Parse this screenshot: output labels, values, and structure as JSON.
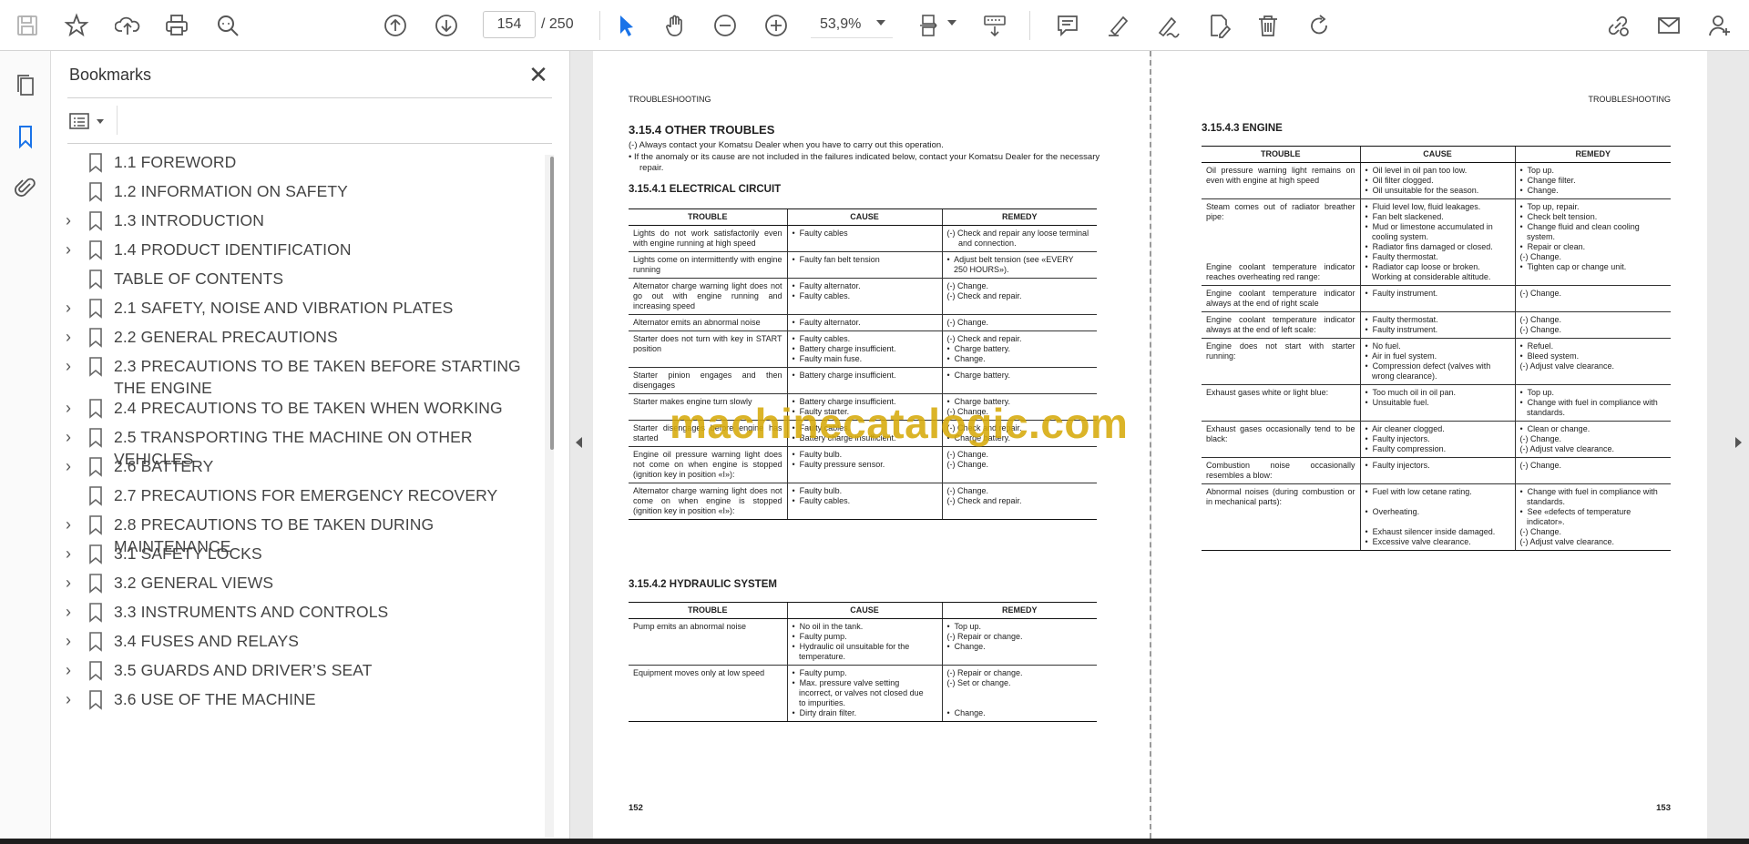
{
  "toolbar": {
    "page_current": "154",
    "page_total": "/  250",
    "zoom": "53,9%"
  },
  "bookmarks": {
    "title": "Bookmarks",
    "items": [
      {
        "label": "1.1 FOREWORD",
        "expandable": false
      },
      {
        "label": "1.2 INFORMATION ON SAFETY",
        "expandable": false
      },
      {
        "label": "1.3 INTRODUCTION",
        "expandable": true
      },
      {
        "label": "1.4 PRODUCT IDENTIFICATION",
        "expandable": true
      },
      {
        "label": "TABLE OF CONTENTS",
        "expandable": false
      },
      {
        "label": "2.1 SAFETY, NOISE AND VIBRATION PLATES",
        "expandable": true
      },
      {
        "label": "2.2 GENERAL PRECAUTIONS",
        "expandable": true
      },
      {
        "label": "2.3 PRECAUTIONS TO BE TAKEN BEFORE STARTING THE ENGINE",
        "expandable": true
      },
      {
        "label": "2.4 PRECAUTIONS TO BE TAKEN WHEN WORKING",
        "expandable": true
      },
      {
        "label": "2.5 TRANSPORTING THE MACHINE ON OTHER VEHICLES",
        "expandable": true
      },
      {
        "label": "2.6 BATTERY",
        "expandable": true
      },
      {
        "label": "2.7 PRECAUTIONS FOR EMERGENCY RECOVERY",
        "expandable": false
      },
      {
        "label": "2.8 PRECAUTIONS TO BE TAKEN DURING MAINTENANCE",
        "expandable": true
      },
      {
        "label": "3.1 SAFETY LOCKS",
        "expandable": true
      },
      {
        "label": "3.2 GENERAL VIEWS",
        "expandable": true
      },
      {
        "label": "3.3 INSTRUMENTS AND CONTROLS",
        "expandable": true
      },
      {
        "label": "3.4 FUSES AND RELAYS",
        "expandable": true
      },
      {
        "label": "3.5 GUARDS AND DRIVER’S SEAT",
        "expandable": true
      },
      {
        "label": "3.6 USE OF THE MACHINE",
        "expandable": true
      }
    ]
  },
  "page_left": {
    "running_head": "TROUBLESHOOTING",
    "heading": "3.15.4 OTHER TROUBLES",
    "note1": "(-) Always contact your Komatsu Dealer when you have to carry out this operation.",
    "note2": "•   If the anomaly or its cause are not included in the failures indicated below, contact your Komatsu Dealer for the necessary repair.",
    "sub1": "3.15.4.1  ELECTRICAL CIRCUIT",
    "sub2": "3.15.4.2  HYDRAULIC SYSTEM",
    "page_number": "152",
    "headers": [
      "TROUBLE",
      "CAUSE",
      "REMEDY"
    ],
    "electrical_rows": [
      {
        "trouble": "Lights do not work satisfactorily even with engine running at high speed",
        "cause": [
          "•  Faulty cables"
        ],
        "remedy": [
          "(-) Check and repair any loose terminal",
          "     and connection."
        ]
      },
      {
        "trouble": "Lights come on intermittently with engine running",
        "cause": [
          "•  Faulty fan belt tension"
        ],
        "remedy": [
          "•  Adjust belt tension (see «EVERY",
          "   250 HOURS»)."
        ]
      },
      {
        "trouble": "Alternator charge warning light does not go out with engine running and increasing speed",
        "cause": [
          "•  Faulty alternator.",
          "•  Faulty cables."
        ],
        "remedy": [
          "(-) Change.",
          "(-) Check and repair."
        ]
      },
      {
        "trouble": "Alternator emits an abnormal noise",
        "cause": [
          "•  Faulty alternator."
        ],
        "remedy": [
          "(-) Change."
        ]
      },
      {
        "trouble": "Starter does not turn with key in START position",
        "cause": [
          "•  Faulty cables.",
          "•  Battery charge insufficient.",
          "•  Faulty main fuse."
        ],
        "remedy": [
          "(-) Check and repair.",
          "•  Charge battery.",
          "•  Change."
        ]
      },
      {
        "trouble": "Starter pinion engages and then disengages",
        "cause": [
          "•  Battery charge insufficient."
        ],
        "remedy": [
          "•  Charge battery."
        ]
      },
      {
        "trouble": "Starter makes engine turn slowly",
        "cause": [
          "•  Battery charge insufficient.",
          "•  Faulty starter."
        ],
        "remedy": [
          "•  Charge battery.",
          "(-) Change."
        ]
      },
      {
        "trouble": "Starter disengages before engine has started",
        "cause": [
          "•  Faulty cables.",
          "•  Battery charge insufficient."
        ],
        "remedy": [
          "(-) Check and repair.",
          "•  Charge battery."
        ]
      },
      {
        "trouble": "Engine oil pressure warning light does not come on when engine is stopped (ignition key in position «I»):",
        "cause": [
          "•  Faulty bulb.",
          "•  Faulty pressure sensor."
        ],
        "remedy": [
          "(-) Change.",
          "(-) Change."
        ]
      },
      {
        "trouble": "Alternator charge warning light does not come on when engine is stopped (ignition key in position «I»):",
        "cause": [
          "•  Faulty bulb.",
          "•  Faulty cables."
        ],
        "remedy": [
          "(-) Change.",
          "(-) Check and repair."
        ]
      }
    ],
    "hydraulic_rows": [
      {
        "trouble": "Pump emits an abnormal noise",
        "cause": [
          "•  No oil in the tank.",
          "•  Faulty pump.",
          "•  Hydraulic oil unsuitable for the",
          "   temperature."
        ],
        "remedy": [
          "•  Top up.",
          "(-) Repair or change.",
          "•  Change."
        ]
      },
      {
        "trouble": "Equipment moves only at low speed",
        "cause": [
          "•  Faulty pump.",
          "•  Max. pressure valve setting",
          "   incorrect, or valves not closed due",
          "   to impurities.",
          "•  Dirty drain filter."
        ],
        "remedy": [
          "(-) Repair or change.",
          "(-) Set or change.",
          "",
          "",
          "•  Change."
        ]
      }
    ]
  },
  "page_right": {
    "running_head": "TROUBLESHOOTING",
    "heading": "3.15.4.3  ENGINE",
    "page_number": "153",
    "headers": [
      "TROUBLE",
      "CAUSE",
      "REMEDY"
    ],
    "engine_rows": [
      {
        "trouble": "Oil pressure warning light remains on even with engine at high speed",
        "cause": [
          "•  Oil level in oil pan too low.",
          "•  Oil filter clogged.",
          "•  Oil unsuitable for the season."
        ],
        "remedy": [
          "•  Top up.",
          "•  Change filter.",
          "•  Change."
        ]
      },
      {
        "trouble": "Steam comes out of radiator breather pipe:\n\n\n\n\nEngine coolant temperature indicator reaches overheating red range:",
        "cause": [
          "•  Fluid level low, fluid leakages.",
          "•  Fan belt slackened.",
          "•  Mud or limestone accumulated in",
          "   cooling system.",
          "•  Radiator fins damaged or closed.",
          "•  Faulty thermostat.",
          "•  Radiator cap loose or broken.",
          "   Working at considerable altitude."
        ],
        "remedy": [
          "•  Top up, repair.",
          "•  Check belt tension.",
          "•  Change fluid and clean cooling",
          "   system.",
          "•  Repair or clean.",
          "(-) Change.",
          "•  Tighten cap or change unit."
        ]
      },
      {
        "trouble": "Engine coolant temperature indicator always at the end of right scale",
        "cause": [
          "•  Faulty instrument."
        ],
        "remedy": [
          "(-) Change."
        ]
      },
      {
        "trouble": "Engine coolant temperature indicator always at the end of left scale:",
        "cause": [
          "•  Faulty thermostat.",
          "•  Faulty instrument."
        ],
        "remedy": [
          "(-) Change.",
          "(-) Change."
        ]
      },
      {
        "trouble": "Engine does not start with starter running:",
        "cause": [
          "•  No fuel.",
          "•  Air in fuel system.",
          "•  Compression defect (valves with",
          "   wrong clearance)."
        ],
        "remedy": [
          "•  Refuel.",
          "•  Bleed system.",
          "(-) Adjust valve clearance."
        ]
      },
      {
        "trouble": "Exhaust gases white or light blue:",
        "cause": [
          "•  Too much oil in oil pan.",
          "•  Unsuitable fuel."
        ],
        "remedy": [
          "•  Top up.",
          "•  Change with fuel in compliance with",
          "   standards."
        ]
      },
      {
        "trouble": "Exhaust gases occasionally tend to be black:",
        "cause": [
          "•  Air cleaner clogged.",
          "•  Faulty injectors.",
          "•  Faulty compression."
        ],
        "remedy": [
          "•  Clean or change.",
          "(-) Change.",
          "(-) Adjust valve clearance."
        ]
      },
      {
        "trouble": "Combustion noise occasionally resembles a blow:",
        "cause": [
          "•  Faulty injectors."
        ],
        "remedy": [
          "(-) Change."
        ]
      },
      {
        "trouble": "Abnormal noises (during combustion or in mechanical parts):",
        "cause": [
          "•  Fuel with low cetane rating.",
          "",
          "•  Overheating.",
          "",
          "•  Exhaust silencer inside damaged.",
          "•  Excessive valve clearance."
        ],
        "remedy": [
          "•  Change with fuel in compliance with",
          "   standards.",
          "•  See «defects of temperature",
          "   indicator».",
          "(-) Change.",
          "(-) Adjust valve clearance."
        ]
      }
    ]
  },
  "watermark": "machinecatalogic.com"
}
